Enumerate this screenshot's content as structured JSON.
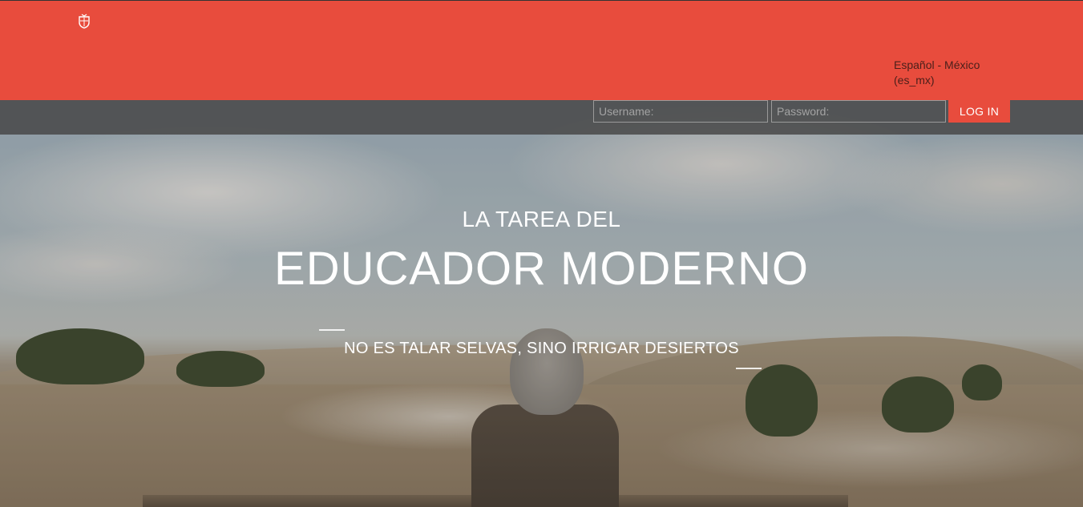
{
  "header": {
    "logo_icon": "crest-logo-icon",
    "language_label": "Español - México (es_mx)",
    "brand_color": "#e84c3d"
  },
  "login": {
    "username_placeholder": "Username:",
    "password_placeholder": "Password:",
    "button_label": "LOG IN"
  },
  "hero": {
    "line1": "LA TAREA DEL",
    "line2": "EDUCADOR MODERNO",
    "tagline": "NO ES TALAR SELVAS, SINO IRRIGAR DESIERTOS"
  }
}
